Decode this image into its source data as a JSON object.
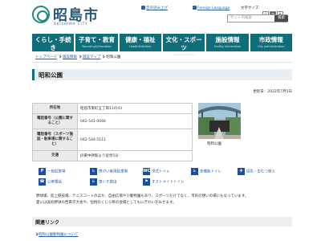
{
  "header": {
    "site_name": "昭島市",
    "site_name_en": "AKISHIMA CITY",
    "util_pc": "音声読み上げ",
    "util_lang": "Foreign Language",
    "font_size_label": "文字サイズ",
    "font_sizes": [
      "小",
      "中",
      "大"
    ],
    "search_placeholder": "サイト内検索",
    "search_button": "検索"
  },
  "nav": [
    {
      "label": "くらし・手続き",
      "en": "Living guide"
    },
    {
      "label": "子育て・教育",
      "en": "Parenting&Education"
    },
    {
      "label": "健康・福祉",
      "en": "Health&Welfare"
    },
    {
      "label": "文化・スポーツ",
      "en": "Culture&Sports"
    },
    {
      "label": "施設情報",
      "en": "Facility information"
    },
    {
      "label": "市政情報",
      "en": "City administration"
    }
  ],
  "breadcrumb": [
    "トップページ",
    "施設情報",
    "施設マップ",
    "昭和公園"
  ],
  "page": {
    "title": "昭和公園",
    "updated": "更新日：2022年7月5日"
  },
  "info": [
    {
      "label": "所在地",
      "value": "昭島市東町五丁目11の43"
    },
    {
      "label": "電話番号（公園に関すること）",
      "value": "042-541-0046"
    },
    {
      "label": "電話番号（スポーツ施設・駐車場に関すること）",
      "value": "042-544-5111"
    },
    {
      "label": "交通",
      "value": "JR東中神駅より徒歩5分"
    }
  ],
  "photo_caption": "昭和公園",
  "facilities": [
    {
      "badge": "P",
      "label": "一般駐車場"
    },
    {
      "badge": "♿",
      "label": "障がい者用駐車場"
    },
    {
      "badge": "WC",
      "label": "洋式トイレ"
    },
    {
      "badge": "♿",
      "label": "多機能トイレ"
    },
    {
      "badge": "✚",
      "label": "授乳・おむつ替え"
    },
    {
      "badge": "☎",
      "label": "公衆電話"
    },
    {
      "badge": "♿",
      "label": "車いす貸出"
    },
    {
      "badge": "⚑",
      "label": "オストメイトトイレ"
    }
  ],
  "description": [
    "野球場、陸上競技場、テニスコートのほか、自由広場や小動物園もあり、スポーツだけでなく、市民の憩いの場にもなっています。",
    "夏には高校野球の西東京大会や、恒例のくじら祭の会場としてもにぎわいをみせます。"
  ],
  "related": {
    "heading": "関連リンク",
    "links": [
      "昭和公園動物園について"
    ]
  }
}
